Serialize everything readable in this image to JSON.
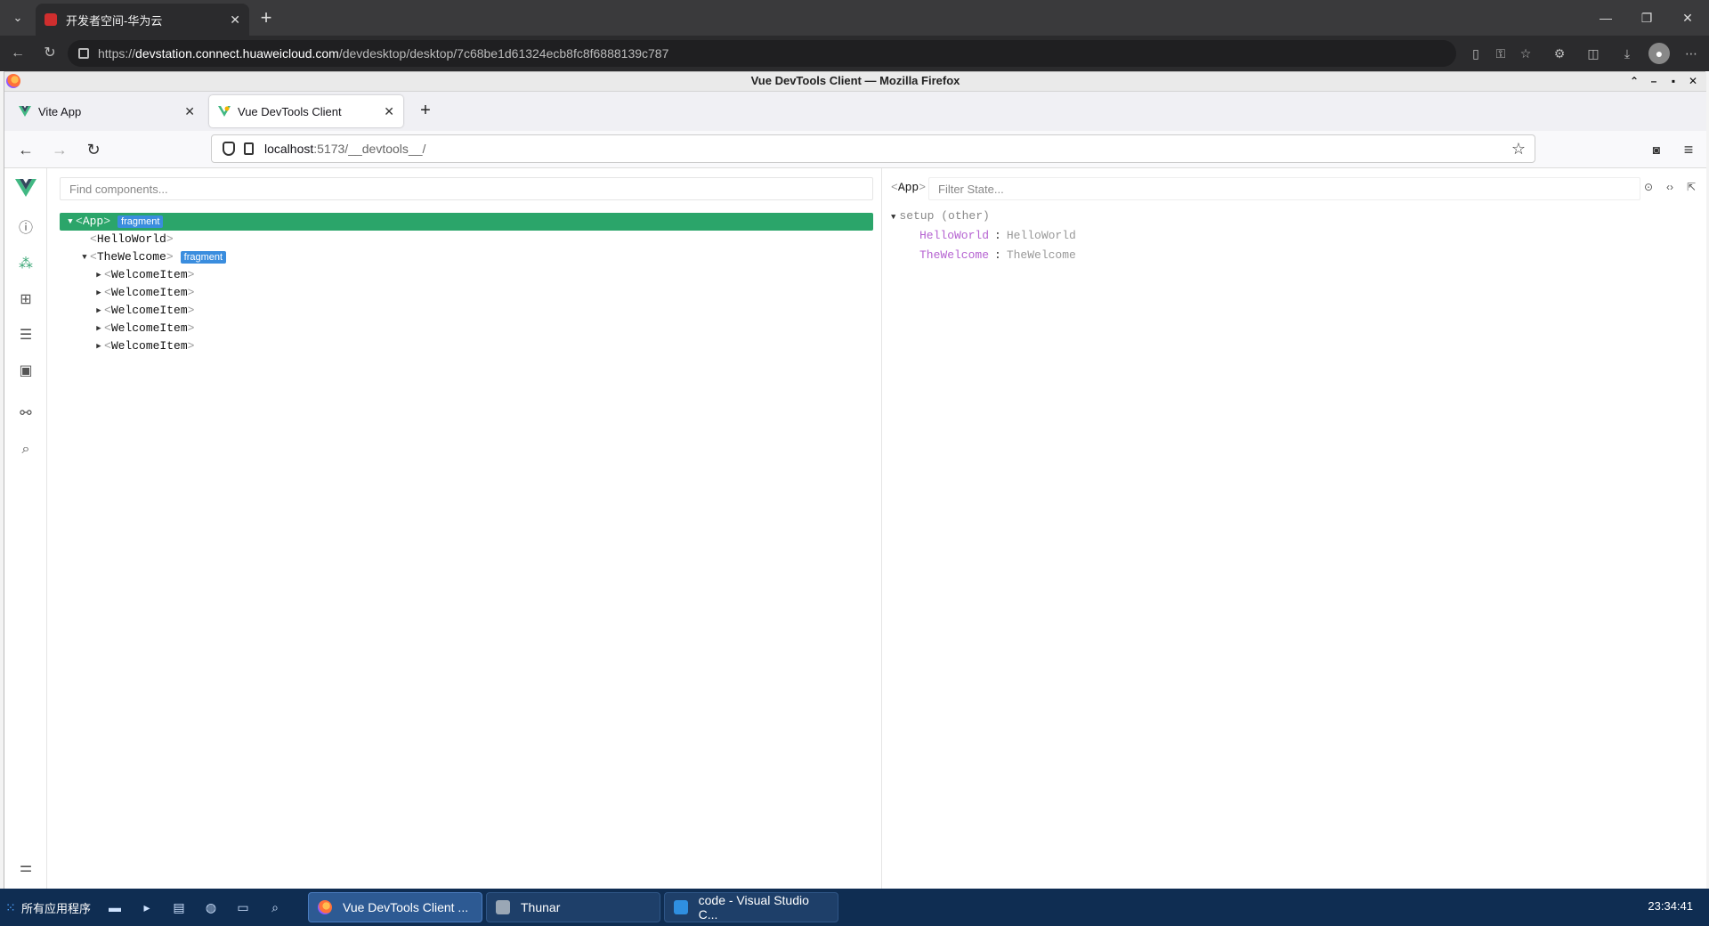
{
  "edge": {
    "tab_title": "开发者空间-华为云",
    "url_prefix": "https://",
    "url_host": "devstation.connect.huaweicloud.com",
    "url_path": "/devdesktop/desktop/7c68be1d61324ecb8fc8f6888139c787"
  },
  "firefox": {
    "window_title": "Vue DevTools Client — Mozilla Firefox",
    "tabs": [
      {
        "label": "Vite App",
        "active": false
      },
      {
        "label": "Vue DevTools Client",
        "active": true
      }
    ],
    "url_host": "localhost",
    "url_path": ":5173/__devtools__/"
  },
  "devtools": {
    "find_placeholder": "Find components...",
    "tree": [
      {
        "open": "<",
        "name": "App",
        "close": ">",
        "badge": "fragment",
        "expanded": true
      },
      {
        "open": "<",
        "name": "HelloWorld",
        "close": ">",
        "badge": ""
      },
      {
        "open": "<",
        "name": "TheWelcome",
        "close": ">",
        "badge": "fragment",
        "expanded": true
      },
      {
        "open": "<",
        "name": "WelcomeItem",
        "close": ">",
        "badge": ""
      },
      {
        "open": "<",
        "name": "WelcomeItem",
        "close": ">",
        "badge": ""
      },
      {
        "open": "<",
        "name": "WelcomeItem",
        "close": ">",
        "badge": ""
      },
      {
        "open": "<",
        "name": "WelcomeItem",
        "close": ">",
        "badge": ""
      },
      {
        "open": "<",
        "name": "WelcomeItem",
        "close": ">",
        "badge": ""
      }
    ],
    "selected_component": "App",
    "filter_placeholder": "Filter State...",
    "setup_header": "setup (other)",
    "state": [
      {
        "key": "HelloWorld",
        "value": "HelloWorld"
      },
      {
        "key": "TheWelcome",
        "value": "TheWelcome"
      }
    ]
  },
  "taskbar": {
    "start_label": "所有应用程序",
    "apps": [
      {
        "label": "Vue DevTools Client ...",
        "active": true
      },
      {
        "label": "Thunar",
        "active": false
      },
      {
        "label": "code - Visual Studio C...",
        "active": false
      }
    ],
    "clock": "23:34:41"
  },
  "colors": {
    "vue_green": "#2ba56a",
    "badge_blue": "#3a8dde",
    "state_key": "#b562d1",
    "taskbar": "#0f2d52"
  }
}
